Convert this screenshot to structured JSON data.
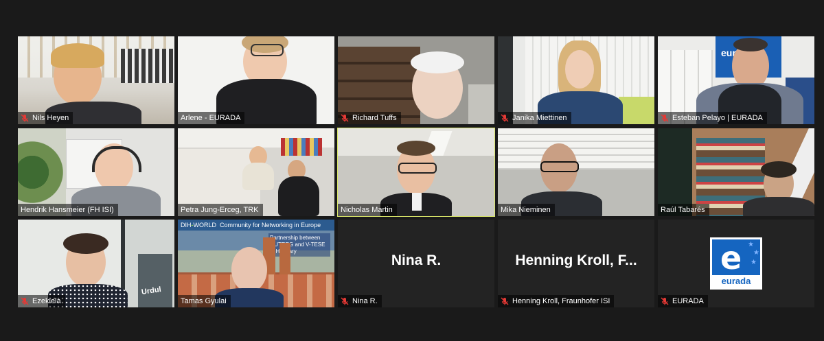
{
  "participants": [
    {
      "name": "Nils Heyen",
      "muted": true
    },
    {
      "name": "Arlene - EURADA",
      "muted": false
    },
    {
      "name": "Richard Tuffs",
      "muted": true
    },
    {
      "name": "Janika Miettinen",
      "muted": true
    },
    {
      "name": "Esteban Pelayo | EURADA",
      "muted": true
    },
    {
      "name": "Hendrik Hansmeier (FH ISI)",
      "muted": false
    },
    {
      "name": "Petra Jung-Erceg, TRK",
      "muted": false
    },
    {
      "name": "Nicholas Martin",
      "muted": false,
      "active_speaker": true
    },
    {
      "name": "Mika Nieminen",
      "muted": false
    },
    {
      "name": "Raúl Tabarés",
      "muted": false
    },
    {
      "name": "Ezekiela",
      "muted": true
    },
    {
      "name": "Tamas Gyulai",
      "muted": false
    },
    {
      "name": "Nina R.",
      "muted": true,
      "video_off": true,
      "display_name": "Nina R."
    },
    {
      "name": "Henning Kroll, Fraunhofer ISI",
      "muted": true,
      "video_off": true,
      "display_name": "Henning Kroll,  F..."
    },
    {
      "name": "EURADA",
      "muted": true,
      "logo": true
    }
  ],
  "eurada_logo_text": "eurada",
  "esteban_banner_text": "eurada",
  "urdula_sign_text": "Urdul",
  "tamas_background": {
    "brand": "DIH",
    "brand_suffix": "WORLD",
    "tagline": "Community for Networking in Europe",
    "overlay": "Partnership between OUTREG and V-TESE in Hungary"
  },
  "colors": {
    "background": "#1a1a1a",
    "active_border": "#d9e66a",
    "mute_icon": "#e53935",
    "label_bg": "rgba(0,0,0,0.55)"
  }
}
